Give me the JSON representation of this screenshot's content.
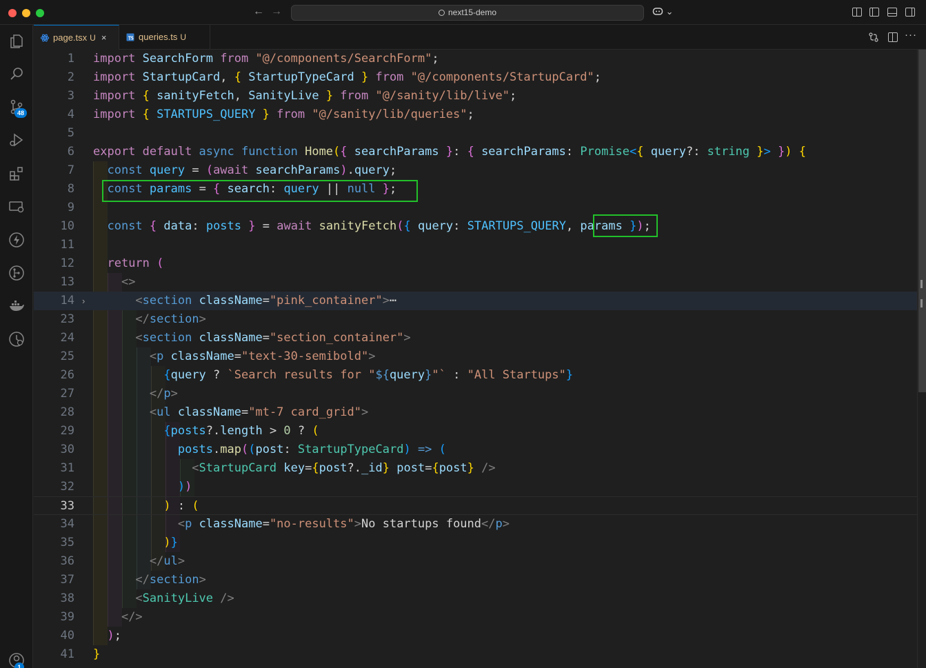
{
  "window": {
    "title": "next15-demo",
    "nav_back": "←",
    "nav_forward": "→",
    "copilot_label": "⌄"
  },
  "activity_bar": {
    "items": [
      {
        "name": "explorer",
        "icon": "files-icon"
      },
      {
        "name": "search",
        "icon": "search-icon"
      },
      {
        "name": "source-control",
        "icon": "source-control-icon",
        "badge": "48"
      },
      {
        "name": "run-debug",
        "icon": "run-debug-icon"
      },
      {
        "name": "extensions",
        "icon": "extensions-icon"
      },
      {
        "name": "remote-explorer",
        "icon": "remote-explorer-icon"
      },
      {
        "name": "thunder",
        "icon": "lightning-icon"
      },
      {
        "name": "gitlens",
        "icon": "gitlens-icon"
      },
      {
        "name": "docker",
        "icon": "docker-icon"
      },
      {
        "name": "timeline",
        "icon": "timeline-icon"
      },
      {
        "name": "accounts",
        "icon": "accounts-icon",
        "badge": "1"
      }
    ]
  },
  "tabs": [
    {
      "label": "page.tsx",
      "status": "U",
      "active": true,
      "close": "×"
    },
    {
      "label": "queries.ts",
      "status": "U",
      "active": false
    }
  ],
  "editor": {
    "active_line": 33,
    "lines": [
      {
        "n": "1",
        "tokens": [
          [
            "kc",
            "import "
          ],
          [
            "var",
            "SearchForm "
          ],
          [
            "kc",
            "from "
          ],
          [
            "str",
            "\"@/components/SearchForm\""
          ],
          [
            "txt",
            ";"
          ]
        ]
      },
      {
        "n": "2",
        "tokens": [
          [
            "kc",
            "import "
          ],
          [
            "var",
            "StartupCard"
          ],
          [
            "txt",
            ", "
          ],
          [
            "b1",
            "{ "
          ],
          [
            "var",
            "StartupTypeCard "
          ],
          [
            "b1",
            "} "
          ],
          [
            "kc",
            "from "
          ],
          [
            "str",
            "\"@/components/StartupCard\""
          ],
          [
            "txt",
            ";"
          ]
        ]
      },
      {
        "n": "3",
        "tokens": [
          [
            "kc",
            "import "
          ],
          [
            "b1",
            "{ "
          ],
          [
            "var",
            "sanityFetch"
          ],
          [
            "txt",
            ", "
          ],
          [
            "var",
            "SanityLive "
          ],
          [
            "b1",
            "} "
          ],
          [
            "kc",
            "from "
          ],
          [
            "str",
            "\"@/sanity/lib/live\""
          ],
          [
            "txt",
            ";"
          ]
        ]
      },
      {
        "n": "4",
        "tokens": [
          [
            "kc",
            "import "
          ],
          [
            "b1",
            "{ "
          ],
          [
            "cst",
            "STARTUPS_QUERY "
          ],
          [
            "b1",
            "} "
          ],
          [
            "kc",
            "from "
          ],
          [
            "str",
            "\"@/sanity/lib/queries\""
          ],
          [
            "txt",
            ";"
          ]
        ]
      },
      {
        "n": "5",
        "tokens": []
      },
      {
        "n": "6",
        "tokens": [
          [
            "kc",
            "export "
          ],
          [
            "kc",
            "default "
          ],
          [
            "kw",
            "async "
          ],
          [
            "kw",
            "function "
          ],
          [
            "fn",
            "Home"
          ],
          [
            "b1",
            "("
          ],
          [
            "b2",
            "{ "
          ],
          [
            "var",
            "searchParams "
          ],
          [
            "b2",
            "}"
          ],
          [
            "txt",
            ": "
          ],
          [
            "b2",
            "{ "
          ],
          [
            "var",
            "searchParams"
          ],
          [
            "txt",
            ": "
          ],
          [
            "typ",
            "Promise"
          ],
          [
            "b3",
            "<"
          ],
          [
            "b1",
            "{ "
          ],
          [
            "var",
            "query"
          ],
          [
            "txt",
            "?: "
          ],
          [
            "typ",
            "string "
          ],
          [
            "b1",
            "}"
          ],
          [
            "b3",
            "> "
          ],
          [
            "b2",
            "}"
          ],
          [
            "b1",
            ") "
          ],
          [
            "b1",
            "{"
          ]
        ]
      },
      {
        "n": "7",
        "tokens": [
          [
            "txt",
            "  "
          ],
          [
            "kw",
            "const "
          ],
          [
            "cst",
            "query "
          ],
          [
            "txt",
            "= "
          ],
          [
            "b2",
            "("
          ],
          [
            "kc",
            "await "
          ],
          [
            "var",
            "searchParams"
          ],
          [
            "b2",
            ")"
          ],
          [
            "txt",
            "."
          ],
          [
            "var",
            "query"
          ],
          [
            "txt",
            ";"
          ]
        ]
      },
      {
        "n": "8",
        "tokens": [
          [
            "txt",
            "  "
          ],
          [
            "kw",
            "const "
          ],
          [
            "cst",
            "params "
          ],
          [
            "txt",
            "= "
          ],
          [
            "b2",
            "{ "
          ],
          [
            "var",
            "search"
          ],
          [
            "txt",
            ": "
          ],
          [
            "cst",
            "query "
          ],
          [
            "txt",
            "|| "
          ],
          [
            "kw",
            "null "
          ],
          [
            "b2",
            "}"
          ],
          [
            "txt",
            ";"
          ]
        ]
      },
      {
        "n": "9",
        "tokens": []
      },
      {
        "n": "10",
        "tokens": [
          [
            "txt",
            "  "
          ],
          [
            "kw",
            "const "
          ],
          [
            "b2",
            "{ "
          ],
          [
            "var",
            "data"
          ],
          [
            "txt",
            ": "
          ],
          [
            "cst",
            "posts "
          ],
          [
            "b2",
            "} "
          ],
          [
            "txt",
            "= "
          ],
          [
            "kc",
            "await "
          ],
          [
            "fn",
            "sanityFetch"
          ],
          [
            "b2",
            "("
          ],
          [
            "b3",
            "{ "
          ],
          [
            "var",
            "query"
          ],
          [
            "txt",
            ": "
          ],
          [
            "cst",
            "STARTUPS_QUERY"
          ],
          [
            "txt",
            ", "
          ],
          [
            "var",
            "params "
          ],
          [
            "b3",
            "}"
          ],
          [
            "b2",
            ")"
          ],
          [
            "txt",
            ";"
          ]
        ]
      },
      {
        "n": "11",
        "tokens": []
      },
      {
        "n": "12",
        "tokens": [
          [
            "txt",
            "  "
          ],
          [
            "kc",
            "return "
          ],
          [
            "b2",
            "("
          ]
        ]
      },
      {
        "n": "13",
        "tokens": [
          [
            "txt",
            "    "
          ],
          [
            "tag",
            "<>"
          ]
        ]
      },
      {
        "n": "14",
        "tokens": [
          [
            "txt",
            "      "
          ],
          [
            "tag",
            "<"
          ],
          [
            "tgn",
            "section "
          ],
          [
            "att",
            "className"
          ],
          [
            "txt",
            "="
          ],
          [
            "str",
            "\"pink_container\""
          ],
          [
            "tag",
            ">"
          ],
          [
            "txt",
            "⋯"
          ]
        ],
        "folded": true
      },
      {
        "n": "23",
        "tokens": [
          [
            "txt",
            "      "
          ],
          [
            "tag",
            "</"
          ],
          [
            "tgn",
            "section"
          ],
          [
            "tag",
            ">"
          ]
        ]
      },
      {
        "n": "24",
        "tokens": [
          [
            "txt",
            "      "
          ],
          [
            "tag",
            "<"
          ],
          [
            "tgn",
            "section "
          ],
          [
            "att",
            "className"
          ],
          [
            "txt",
            "="
          ],
          [
            "str",
            "\"section_container\""
          ],
          [
            "tag",
            ">"
          ]
        ]
      },
      {
        "n": "25",
        "tokens": [
          [
            "txt",
            "        "
          ],
          [
            "tag",
            "<"
          ],
          [
            "tgn",
            "p "
          ],
          [
            "att",
            "className"
          ],
          [
            "txt",
            "="
          ],
          [
            "str",
            "\"text-30-semibold\""
          ],
          [
            "tag",
            ">"
          ]
        ]
      },
      {
        "n": "26",
        "tokens": [
          [
            "txt",
            "          "
          ],
          [
            "b3",
            "{"
          ],
          [
            "var",
            "query "
          ],
          [
            "txt",
            "? "
          ],
          [
            "str",
            "`Search results for \""
          ],
          [
            "kw",
            "${"
          ],
          [
            "var",
            "query"
          ],
          [
            "kw",
            "}"
          ],
          [
            "str",
            "\"` "
          ],
          [
            "txt",
            ": "
          ],
          [
            "str",
            "\"All Startups\""
          ],
          [
            "b3",
            "}"
          ]
        ]
      },
      {
        "n": "27",
        "tokens": [
          [
            "txt",
            "        "
          ],
          [
            "tag",
            "</"
          ],
          [
            "tgn",
            "p"
          ],
          [
            "tag",
            ">"
          ]
        ]
      },
      {
        "n": "28",
        "tokens": [
          [
            "txt",
            "        "
          ],
          [
            "tag",
            "<"
          ],
          [
            "tgn",
            "ul "
          ],
          [
            "att",
            "className"
          ],
          [
            "txt",
            "="
          ],
          [
            "str",
            "\"mt-7 card_grid\""
          ],
          [
            "tag",
            ">"
          ]
        ]
      },
      {
        "n": "29",
        "tokens": [
          [
            "txt",
            "          "
          ],
          [
            "b3",
            "{"
          ],
          [
            "cst",
            "posts"
          ],
          [
            "txt",
            "?."
          ],
          [
            "var",
            "length "
          ],
          [
            "txt",
            "> "
          ],
          [
            "num",
            "0 "
          ],
          [
            "txt",
            "? "
          ],
          [
            "b1",
            "("
          ]
        ]
      },
      {
        "n": "30",
        "tokens": [
          [
            "txt",
            "            "
          ],
          [
            "cst",
            "posts"
          ],
          [
            "txt",
            "."
          ],
          [
            "fn",
            "map"
          ],
          [
            "b2",
            "("
          ],
          [
            "b3",
            "("
          ],
          [
            "var",
            "post"
          ],
          [
            "txt",
            ": "
          ],
          [
            "typ",
            "StartupTypeCard"
          ],
          [
            "b3",
            ") "
          ],
          [
            "kw",
            "=> "
          ],
          [
            "b3",
            "("
          ]
        ]
      },
      {
        "n": "31",
        "tokens": [
          [
            "txt",
            "              "
          ],
          [
            "tag",
            "<"
          ],
          [
            "cmp",
            "StartupCard "
          ],
          [
            "att",
            "key"
          ],
          [
            "txt",
            "="
          ],
          [
            "b1",
            "{"
          ],
          [
            "var",
            "post"
          ],
          [
            "txt",
            "?."
          ],
          [
            "var",
            "_id"
          ],
          [
            "b1",
            "} "
          ],
          [
            "att",
            "post"
          ],
          [
            "txt",
            "="
          ],
          [
            "b1",
            "{"
          ],
          [
            "var",
            "post"
          ],
          [
            "b1",
            "} "
          ],
          [
            "tag",
            "/>"
          ]
        ]
      },
      {
        "n": "32",
        "tokens": [
          [
            "txt",
            "            "
          ],
          [
            "b3",
            ")"
          ],
          [
            "b2",
            ")"
          ]
        ]
      },
      {
        "n": "33",
        "tokens": [
          [
            "txt",
            "          "
          ],
          [
            "b1",
            ") "
          ],
          [
            "txt",
            ": "
          ],
          [
            "b1",
            "("
          ]
        ]
      },
      {
        "n": "34",
        "tokens": [
          [
            "txt",
            "            "
          ],
          [
            "tag",
            "<"
          ],
          [
            "tgn",
            "p "
          ],
          [
            "att",
            "className"
          ],
          [
            "txt",
            "="
          ],
          [
            "str",
            "\"no-results\""
          ],
          [
            "tag",
            ">"
          ],
          [
            "txt",
            "No startups found"
          ],
          [
            "tag",
            "</"
          ],
          [
            "tgn",
            "p"
          ],
          [
            "tag",
            ">"
          ]
        ]
      },
      {
        "n": "35",
        "tokens": [
          [
            "txt",
            "          "
          ],
          [
            "b1",
            ")"
          ],
          [
            "b3",
            "}"
          ]
        ]
      },
      {
        "n": "36",
        "tokens": [
          [
            "txt",
            "        "
          ],
          [
            "tag",
            "</"
          ],
          [
            "tgn",
            "ul"
          ],
          [
            "tag",
            ">"
          ]
        ]
      },
      {
        "n": "37",
        "tokens": [
          [
            "txt",
            "      "
          ],
          [
            "tag",
            "</"
          ],
          [
            "tgn",
            "section"
          ],
          [
            "tag",
            ">"
          ]
        ]
      },
      {
        "n": "38",
        "tokens": [
          [
            "txt",
            "      "
          ],
          [
            "tag",
            "<"
          ],
          [
            "cmp",
            "SanityLive "
          ],
          [
            "tag",
            "/>"
          ]
        ]
      },
      {
        "n": "39",
        "tokens": [
          [
            "txt",
            "    "
          ],
          [
            "tag",
            "</>"
          ]
        ]
      },
      {
        "n": "40",
        "tokens": [
          [
            "txt",
            "  "
          ],
          [
            "b2",
            ")"
          ],
          [
            "txt",
            ";"
          ]
        ]
      },
      {
        "n": "41",
        "tokens": [
          [
            "b1",
            "}"
          ]
        ]
      }
    ]
  },
  "colors": {
    "highlight_box": "#22c02a",
    "accent": "#0078d4"
  }
}
